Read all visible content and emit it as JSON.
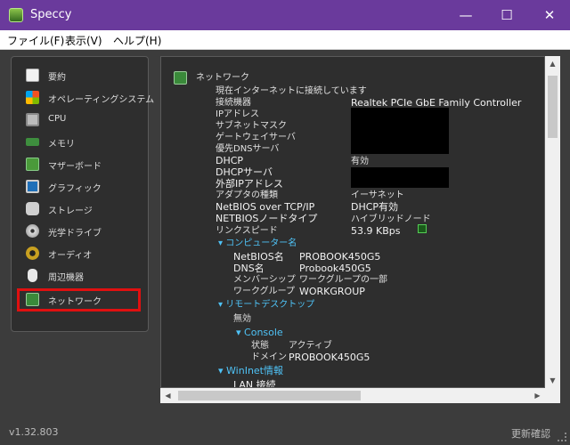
{
  "window": {
    "title": "Speccy"
  },
  "menu": {
    "file": "ファイル(F)",
    "view": "表示(V)",
    "help": "ヘルプ(H)"
  },
  "sidebar": {
    "items": [
      {
        "label": "要約",
        "icon": "summary-icon"
      },
      {
        "label": "オペレーティングシステム",
        "icon": "windows-logo-icon"
      },
      {
        "label": "CPU",
        "icon": "cpu-icon"
      },
      {
        "label": "メモリ",
        "icon": "memory-icon"
      },
      {
        "label": "マザーボード",
        "icon": "motherboard-icon"
      },
      {
        "label": "グラフィック",
        "icon": "monitor-icon"
      },
      {
        "label": "ストレージ",
        "icon": "storage-icon"
      },
      {
        "label": "光学ドライブ",
        "icon": "optical-disc-icon"
      },
      {
        "label": "オーディオ",
        "icon": "speaker-icon"
      },
      {
        "label": "周辺機器",
        "icon": "mouse-icon"
      },
      {
        "label": "ネットワーク",
        "icon": "network-icon"
      }
    ],
    "selected_index": 10
  },
  "content": {
    "heading": "ネットワーク",
    "connected_text": "現在インターネットに接続しています",
    "props": [
      {
        "label": "接続機器",
        "value": "Realtek PCIe GbE Family Controller"
      },
      {
        "label": "IPアドレス",
        "value": ""
      },
      {
        "label": "サブネットマスク",
        "value": ""
      },
      {
        "label": "ゲートウェイサーバ",
        "value": ""
      },
      {
        "label": "優先DNSサーバ",
        "value": ""
      },
      {
        "label": "DHCP",
        "value": "有効"
      },
      {
        "label": "DHCPサーバ",
        "value": ""
      },
      {
        "label": "外部IPアドレス",
        "value": ""
      },
      {
        "label": "アダプタの種類",
        "value": "イーサネット"
      },
      {
        "label": "NetBIOS over TCP/IP",
        "value": "DHCP有効"
      },
      {
        "label": "NETBIOSノードタイプ",
        "value": "ハイブリッドノード"
      },
      {
        "label": "リンクスピード",
        "value": "53.9 KBps"
      }
    ],
    "computer_name_section": "コンピューター名",
    "computer_name_props": [
      {
        "label": "NetBIOS名",
        "value": "PROBOOK450G5"
      },
      {
        "label": "DNS名",
        "value": "Probook450G5"
      },
      {
        "label": "メンバーシップ",
        "value": "ワークグループの一部"
      },
      {
        "label": "ワークグループ",
        "value": "WORKGROUP"
      }
    ],
    "remote_section": "リモートデスクトップ",
    "remote_status": "無効",
    "console_section": "Console",
    "console_props": [
      {
        "label": "状態",
        "value": "アクティブ"
      },
      {
        "label": "ドメイン",
        "value": "PROBOOK450G5"
      }
    ],
    "wininet_section": "WinInet情報",
    "lan_text": "LAN 接続"
  },
  "status": {
    "version": "v1.32.803",
    "update": "更新確認"
  },
  "colors": {
    "titlebar": "#6a3a9c",
    "accent": "#4fc3f7",
    "selection": "#e01010"
  }
}
